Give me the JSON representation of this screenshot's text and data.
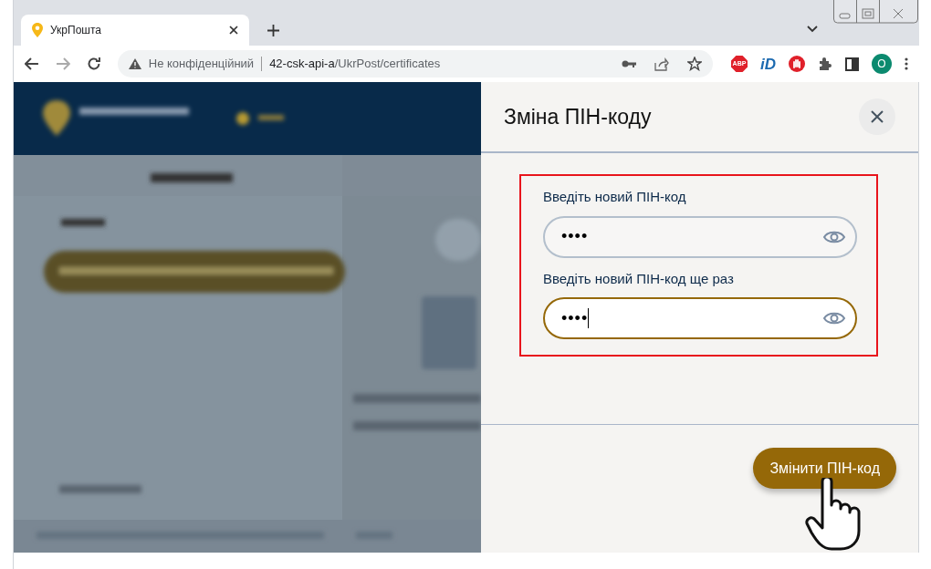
{
  "browser": {
    "tab": {
      "title": "УкрПошта",
      "selected": true
    },
    "address": {
      "security": "Не конфіденційний",
      "host": "42-csk-api-a",
      "path": "/UkrPost/certificates"
    },
    "extensions": [
      {
        "kind": "abp",
        "label": "ABP"
      },
      {
        "kind": "id",
        "label": "iD"
      }
    ],
    "profile_initial": "O"
  },
  "dialog": {
    "title": "Зміна ПІН-коду",
    "highlighted": true,
    "fields": [
      {
        "label": "Введіть новий ПІН-код",
        "value": "••••",
        "focused": false
      },
      {
        "label": "Введіть новий ПІН-код ще раз",
        "value": "••••",
        "focused": true
      }
    ],
    "submit": "Змінити ПІН-код"
  }
}
